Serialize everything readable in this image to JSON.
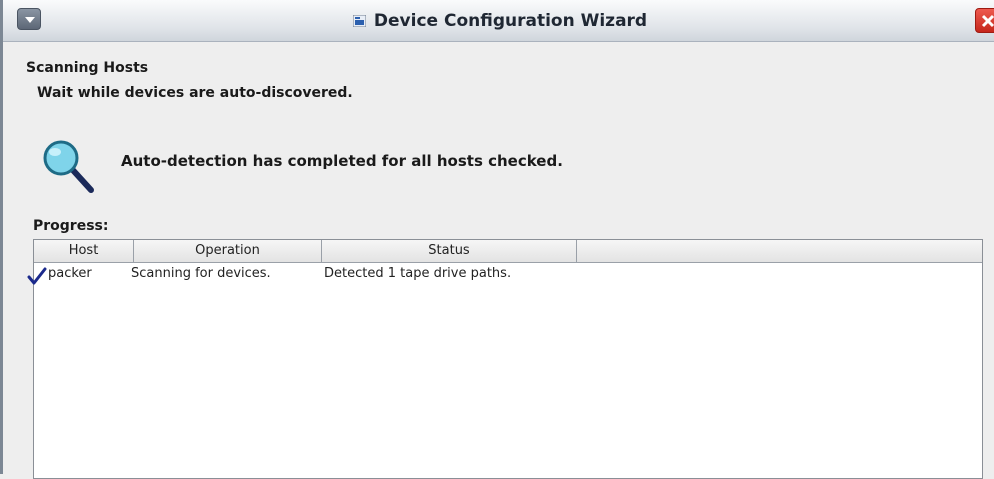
{
  "window": {
    "title": "Device Configuration Wizard"
  },
  "header": {
    "heading": "Scanning Hosts",
    "subheading": "Wait while devices are auto-discovered."
  },
  "status": {
    "icon": "magnifier-icon",
    "message": "Auto-detection has completed for all hosts checked."
  },
  "progress": {
    "label": "Progress:",
    "columns": [
      "Host",
      "Operation",
      "Status"
    ],
    "rows": [
      {
        "icon": "checkmark-icon",
        "host": "packer",
        "operation": "Scanning for devices.",
        "status": "Detected 1 tape drive paths."
      }
    ]
  },
  "colors": {
    "titlebar": "#dfe3e8",
    "close_button": "#d9372b",
    "check": "#1b2a8c",
    "magnifier_lens": "#7fd4ea"
  }
}
